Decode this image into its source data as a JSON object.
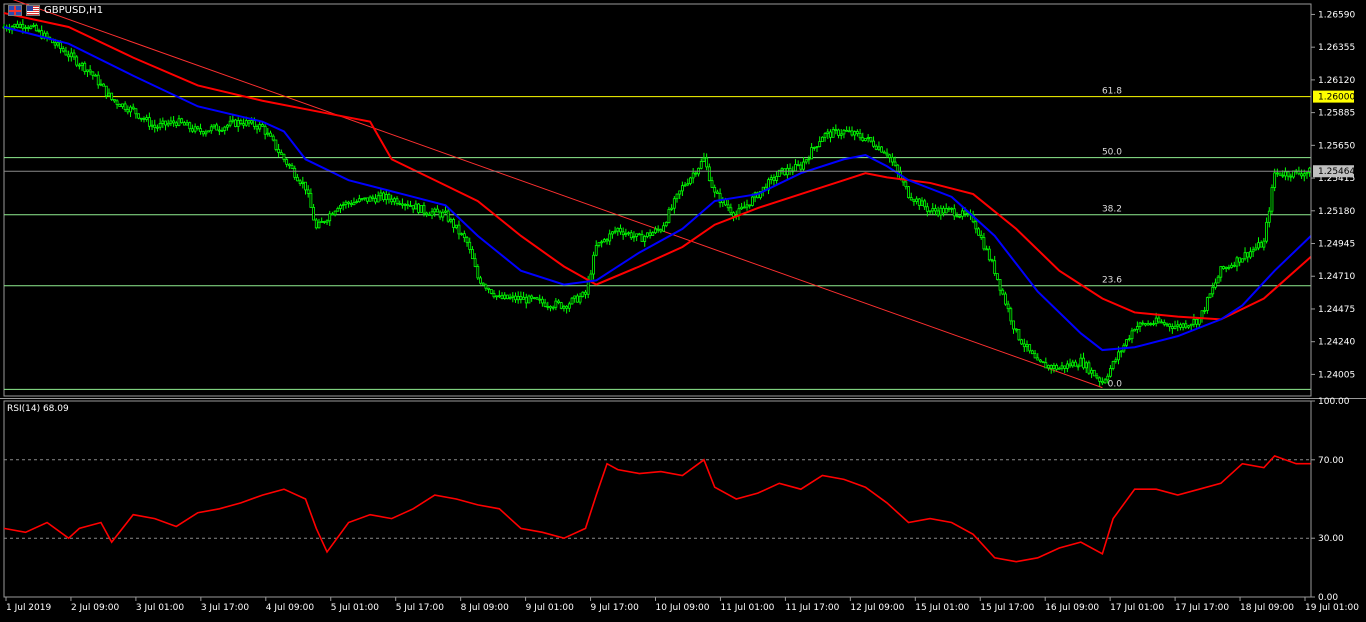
{
  "chart_title": {
    "symbol_timeframe": "GBPUSD,H1",
    "icon_names": [
      "gb-flag-icon",
      "us-flag-icon"
    ]
  },
  "colors": {
    "background": "#000000",
    "candles": "#00ff00",
    "ma_fast": "#0000ff",
    "ma_slow": "#ff0000",
    "fib_levels": "#90ee90",
    "fib_top": "#ffff00",
    "trendline": "#ff3030",
    "rsi_line": "#ff0000",
    "price_tag_bg": "#ffff00",
    "bid_tag_bg": "#c0c0c0"
  },
  "price_axis": {
    "ticks": [
      "1.26590",
      "1.26355",
      "1.26120",
      "1.25885",
      "1.25650",
      "1.25415",
      "1.25180",
      "1.24945",
      "1.24710",
      "1.24475",
      "1.24240",
      "1.24005"
    ],
    "range": [
      1.2385,
      1.26665
    ],
    "highlight_label": "1.26000",
    "highlight_value": 1.26,
    "bid_label": "1.25464",
    "bid_value": 1.25464
  },
  "fib_levels": [
    {
      "label": "61.8",
      "price": 1.26
    },
    {
      "label": "50.0",
      "price": 1.25562
    },
    {
      "label": "38.2",
      "price": 1.25152
    },
    {
      "label": "23.6",
      "price": 1.24642
    },
    {
      "label": "0.0",
      "price": 1.23898
    }
  ],
  "time_axis": {
    "labels": [
      "1 Jul 2019",
      "2 Jul 09:00",
      "3 Jul 01:00",
      "3 Jul 17:00",
      "4 Jul 09:00",
      "5 Jul 01:00",
      "5 Jul 17:00",
      "8 Jul 09:00",
      "9 Jul 01:00",
      "9 Jul 17:00",
      "10 Jul 09:00",
      "11 Jul 01:00",
      "11 Jul 17:00",
      "12 Jul 09:00",
      "15 Jul 01:00",
      "15 Jul 17:00",
      "16 Jul 09:00",
      "17 Jul 01:00",
      "17 Jul 17:00",
      "18 Jul 09:00",
      "19 Jul 01:00"
    ]
  },
  "rsi": {
    "label": "RSI(14) 68.09",
    "value": 68.09,
    "axis_ticks": [
      "100.00",
      "70.00",
      "30.00",
      "0.00"
    ],
    "levels": [
      70,
      30
    ],
    "range": [
      0,
      100
    ]
  },
  "chart_data": {
    "type": "line",
    "price_path": [
      [
        0,
        1.265
      ],
      [
        16,
        1.2652
      ],
      [
        32,
        1.2642
      ],
      [
        48,
        1.263
      ],
      [
        64,
        1.2618
      ],
      [
        80,
        1.2598
      ],
      [
        96,
        1.259
      ],
      [
        112,
        1.2578
      ],
      [
        128,
        1.2582
      ],
      [
        144,
        1.2575
      ],
      [
        160,
        1.2578
      ],
      [
        176,
        1.2582
      ],
      [
        192,
        1.2578
      ],
      [
        208,
        1.2555
      ],
      [
        224,
        1.2535
      ],
      [
        232,
        1.2505
      ],
      [
        248,
        1.2522
      ],
      [
        264,
        1.2525
      ],
      [
        280,
        1.2528
      ],
      [
        296,
        1.2525
      ],
      [
        312,
        1.2518
      ],
      [
        328,
        1.2515
      ],
      [
        344,
        1.2495
      ],
      [
        352,
        1.247
      ],
      [
        368,
        1.2455
      ],
      [
        384,
        1.2455
      ],
      [
        400,
        1.2452
      ],
      [
        416,
        1.245
      ],
      [
        432,
        1.2458
      ],
      [
        440,
        1.2492
      ],
      [
        456,
        1.2505
      ],
      [
        472,
        1.2498
      ],
      [
        488,
        1.2505
      ],
      [
        504,
        1.2535
      ],
      [
        520,
        1.2555
      ],
      [
        528,
        1.253
      ],
      [
        544,
        1.2515
      ],
      [
        560,
        1.253
      ],
      [
        576,
        1.2545
      ],
      [
        592,
        1.255
      ],
      [
        608,
        1.2572
      ],
      [
        624,
        1.2575
      ],
      [
        640,
        1.257
      ],
      [
        656,
        1.256
      ],
      [
        672,
        1.253
      ],
      [
        688,
        1.2518
      ],
      [
        704,
        1.2518
      ],
      [
        720,
        1.2512
      ],
      [
        736,
        1.2475
      ],
      [
        752,
        1.243
      ],
      [
        768,
        1.2408
      ],
      [
        784,
        1.2405
      ],
      [
        800,
        1.241
      ],
      [
        816,
        1.2395
      ],
      [
        824,
        1.2408
      ],
      [
        840,
        1.2435
      ],
      [
        856,
        1.2438
      ],
      [
        872,
        1.2435
      ],
      [
        888,
        1.244
      ],
      [
        904,
        1.2475
      ],
      [
        920,
        1.2485
      ],
      [
        936,
        1.2495
      ],
      [
        944,
        1.2545
      ],
      [
        960,
        1.2545
      ],
      [
        971,
        1.2546
      ]
    ],
    "ma_fast_path": [
      [
        0,
        1.265
      ],
      [
        48,
        1.2638
      ],
      [
        96,
        1.2615
      ],
      [
        144,
        1.2593
      ],
      [
        192,
        1.2582
      ],
      [
        208,
        1.2575
      ],
      [
        224,
        1.2555
      ],
      [
        256,
        1.254
      ],
      [
        296,
        1.253
      ],
      [
        328,
        1.2522
      ],
      [
        352,
        1.25
      ],
      [
        384,
        1.2475
      ],
      [
        416,
        1.2465
      ],
      [
        440,
        1.2468
      ],
      [
        472,
        1.2488
      ],
      [
        504,
        1.2505
      ],
      [
        528,
        1.2525
      ],
      [
        560,
        1.253
      ],
      [
        592,
        1.2545
      ],
      [
        624,
        1.2555
      ],
      [
        640,
        1.2558
      ],
      [
        656,
        1.255
      ],
      [
        672,
        1.254
      ],
      [
        704,
        1.2528
      ],
      [
        736,
        1.25
      ],
      [
        768,
        1.246
      ],
      [
        800,
        1.243
      ],
      [
        816,
        1.2418
      ],
      [
        840,
        1.242
      ],
      [
        872,
        1.2428
      ],
      [
        904,
        1.244
      ],
      [
        920,
        1.245
      ],
      [
        944,
        1.2475
      ],
      [
        971,
        1.25
      ]
    ],
    "ma_slow_path": [
      [
        0,
        1.266
      ],
      [
        48,
        1.265
      ],
      [
        96,
        1.2628
      ],
      [
        144,
        1.2608
      ],
      [
        192,
        1.2597
      ],
      [
        240,
        1.2588
      ],
      [
        272,
        1.2582
      ],
      [
        288,
        1.2555
      ],
      [
        320,
        1.254
      ],
      [
        352,
        1.2525
      ],
      [
        384,
        1.25
      ],
      [
        416,
        1.2478
      ],
      [
        440,
        1.2465
      ],
      [
        472,
        1.2478
      ],
      [
        504,
        1.2492
      ],
      [
        528,
        1.2508
      ],
      [
        560,
        1.252
      ],
      [
        592,
        1.253
      ],
      [
        624,
        1.254
      ],
      [
        640,
        1.2545
      ],
      [
        656,
        1.2542
      ],
      [
        688,
        1.2538
      ],
      [
        720,
        1.253
      ],
      [
        752,
        1.2505
      ],
      [
        784,
        1.2475
      ],
      [
        816,
        1.2455
      ],
      [
        840,
        1.2445
      ],
      [
        872,
        1.2442
      ],
      [
        904,
        1.244
      ],
      [
        936,
        1.2455
      ],
      [
        971,
        1.2485
      ]
    ],
    "trendline": [
      [
        0,
        1.2672
      ],
      [
        816,
        1.2391
      ]
    ],
    "rsi_path": [
      [
        0,
        35
      ],
      [
        16,
        33
      ],
      [
        32,
        38
      ],
      [
        48,
        30
      ],
      [
        56,
        35
      ],
      [
        72,
        38
      ],
      [
        80,
        28
      ],
      [
        96,
        42
      ],
      [
        112,
        40
      ],
      [
        128,
        36
      ],
      [
        144,
        43
      ],
      [
        160,
        45
      ],
      [
        176,
        48
      ],
      [
        192,
        52
      ],
      [
        208,
        55
      ],
      [
        224,
        50
      ],
      [
        232,
        35
      ],
      [
        240,
        23
      ],
      [
        256,
        38
      ],
      [
        272,
        42
      ],
      [
        288,
        40
      ],
      [
        304,
        45
      ],
      [
        320,
        52
      ],
      [
        336,
        50
      ],
      [
        352,
        47
      ],
      [
        368,
        45
      ],
      [
        384,
        35
      ],
      [
        400,
        33
      ],
      [
        416,
        30
      ],
      [
        432,
        35
      ],
      [
        440,
        52
      ],
      [
        448,
        68
      ],
      [
        456,
        65
      ],
      [
        472,
        63
      ],
      [
        488,
        64
      ],
      [
        504,
        62
      ],
      [
        520,
        70
      ],
      [
        528,
        56
      ],
      [
        544,
        50
      ],
      [
        560,
        53
      ],
      [
        576,
        58
      ],
      [
        592,
        55
      ],
      [
        608,
        62
      ],
      [
        624,
        60
      ],
      [
        640,
        56
      ],
      [
        656,
        48
      ],
      [
        672,
        38
      ],
      [
        688,
        40
      ],
      [
        704,
        38
      ],
      [
        720,
        32
      ],
      [
        736,
        20
      ],
      [
        752,
        18
      ],
      [
        768,
        20
      ],
      [
        784,
        25
      ],
      [
        800,
        28
      ],
      [
        816,
        22
      ],
      [
        824,
        40
      ],
      [
        840,
        55
      ],
      [
        856,
        55
      ],
      [
        872,
        52
      ],
      [
        888,
        55
      ],
      [
        904,
        58
      ],
      [
        920,
        68
      ],
      [
        936,
        66
      ],
      [
        944,
        72
      ],
      [
        960,
        68
      ],
      [
        971,
        68
      ]
    ]
  }
}
